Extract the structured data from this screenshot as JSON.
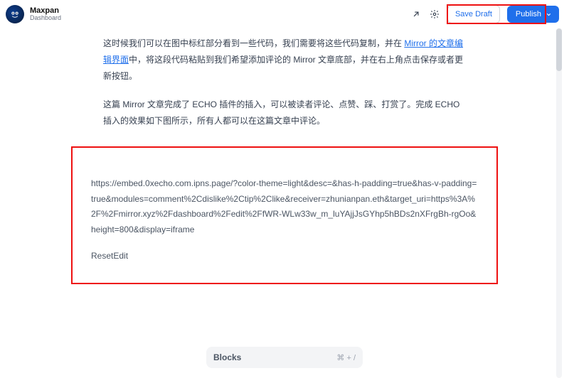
{
  "header": {
    "site_name": "Maxpan",
    "site_sub": "Dashboard",
    "open_icon": "↗",
    "settings_icon": "⚙",
    "save_draft_label": "Save Draft",
    "publish_label": "Publish"
  },
  "article": {
    "p1_pre": "这时候我们可以在图中标红部分看到一些代码，我们需要将这些代码复制，并在 ",
    "p1_link": "Mirror 的文章编辑界面",
    "p1_post": "中，将这段代码粘贴到我们希望添加评论的 Mirror 文章底部，并在右上角点击保存或者更新按钮。",
    "p2": "这篇 Mirror 文章完成了 ECHO 插件的插入，可以被读者评论、点赞、踩、打赏了。完成 ECHO 插入的效果如下图所示，所有人都可以在这篇文章中评论。"
  },
  "embed": {
    "url": "https://embed.0xecho.com.ipns.page/?color-theme=light&desc=&has-h-padding=true&has-v-padding=true&modules=comment%2Cdislike%2Ctip%2Clike&receiver=zhunianpan.eth&target_uri=https%3A%2F%2Fmirror.xyz%2Fdashboard%2Fedit%2FfWR-WLw33w_m_luYAjjJsGYhp5hBDs2nXFrgBh-rgOo&height=800&display=iframe",
    "reset_label": "Reset",
    "edit_label": "Edit"
  },
  "blocks": {
    "label": "Blocks",
    "shortcut": "⌘ + /"
  }
}
